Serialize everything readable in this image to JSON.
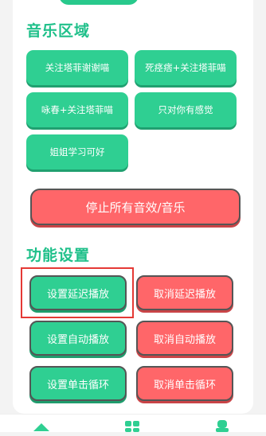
{
  "music_section": {
    "title": "音乐区域",
    "tiles": [
      "关注塔菲谢谢喵",
      "死痉痞+关注塔菲喵",
      "咏春+关注塔菲喵",
      "只对你有感觉",
      "姐姐学习可好"
    ],
    "stop_button": "停止所有音效/音乐"
  },
  "function_section": {
    "title": "功能设置",
    "buttons": [
      {
        "set": "设置延迟播放",
        "cancel": "取消延迟播放"
      },
      {
        "set": "设置自动播放",
        "cancel": "取消自动播放"
      },
      {
        "set": "设置单击循环",
        "cancel": "取消单击循环"
      }
    ]
  },
  "colors": {
    "accent_green": "#2fcf92",
    "accent_red": "#ff6669",
    "highlight_border": "#e53935"
  },
  "tabbar": {
    "icons": [
      "home-icon",
      "grid-icon",
      "user-icon"
    ]
  }
}
